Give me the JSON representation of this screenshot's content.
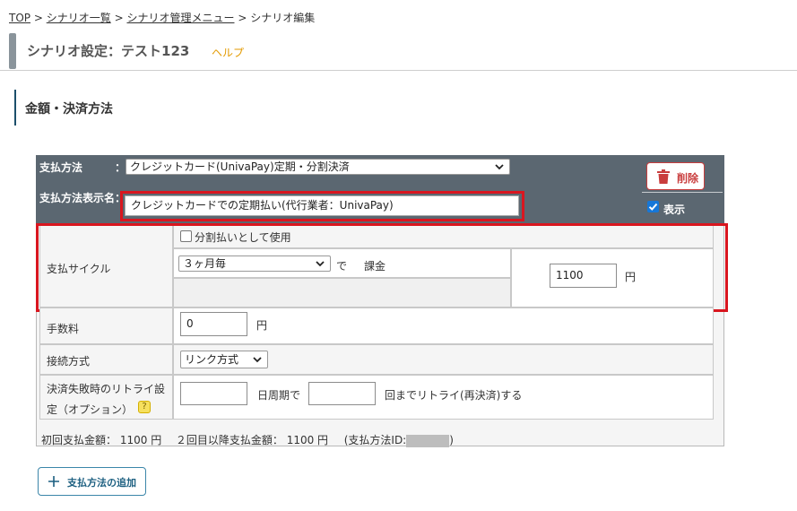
{
  "breadcrumb": {
    "items": [
      "TOP",
      "シナリオ一覧",
      "シナリオ管理メニュー"
    ],
    "current": "シナリオ編集",
    "separator": ">"
  },
  "page": {
    "title": "シナリオ設定：テスト123",
    "help": "ヘルプ"
  },
  "section": {
    "title": "金額・決済方法"
  },
  "payment": {
    "method_label": "支払方法",
    "method_colon": "：",
    "method_value": "クレジットカード(UnivaPay)定期・分割決済",
    "display_name_label": "支払方法表示名",
    "display_name_colon": "：",
    "display_name_value": "クレジットカードでの定期払い(代行業者：UnivaPay)",
    "delete_label": "削除",
    "show_label": "表示",
    "show_checked": true
  },
  "cycle": {
    "label": "支払サイクル",
    "installment_label": "分割払いとして使用",
    "installment_checked": false,
    "period_value": "３ヶ月毎",
    "de": "で",
    "charge": "課金",
    "amount_value": "1100",
    "yen": "円"
  },
  "fee": {
    "label": "手数料",
    "value": "0",
    "yen": "円"
  },
  "connection": {
    "label": "接続方式",
    "value": "リンク方式"
  },
  "retry": {
    "label_line1": "決済失敗時のリトライ設",
    "label_line2": "定（オプション）",
    "help_icon": "?",
    "interval_value": "",
    "interval_suffix": "日周期で",
    "count_value": "",
    "count_suffix": "回までリトライ(再決済)する"
  },
  "summary": {
    "first_label": "初回支払金額：",
    "first_value": "1100 円",
    "second_label": "２回目以降支払金額：",
    "second_value": "1100 円",
    "id_prefix": "(支払方法ID:",
    "id_suffix": ")"
  },
  "add_button": {
    "label": "支払方法の追加"
  },
  "colors": {
    "header_bg": "#5b6771",
    "highlight": "#d9161f",
    "accent": "#1677d8",
    "help": "#e39a00"
  },
  "icons": [
    "trash-icon",
    "check-icon",
    "chevron-down-icon",
    "question-icon",
    "plus-icon"
  ]
}
